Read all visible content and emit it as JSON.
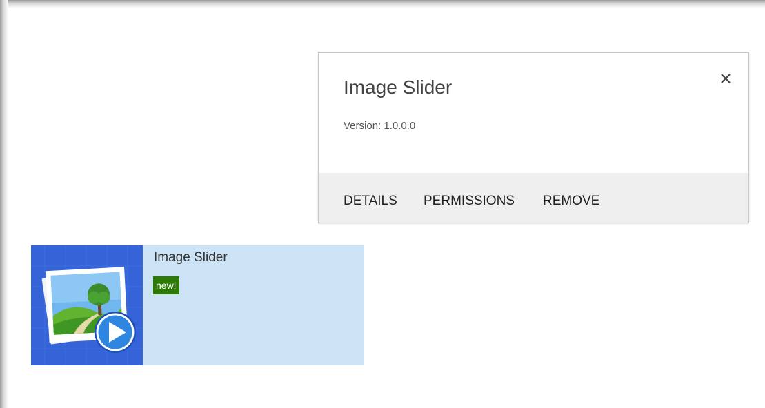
{
  "callout": {
    "title": "Image Slider",
    "version": "Version: 1.0.0.0",
    "close_icon": "close-icon",
    "actions": {
      "details": "DETAILS",
      "permissions": "PERMISSIONS",
      "remove": "REMOVE"
    }
  },
  "tile": {
    "title": "Image Slider",
    "badge": "new!",
    "icon": "image-slider-app-icon"
  },
  "colors": {
    "tile_background": "#cce3f6",
    "icon_background": "#3564d8",
    "badge_background": "#2d7a06",
    "action_bar_background": "#efefef"
  }
}
